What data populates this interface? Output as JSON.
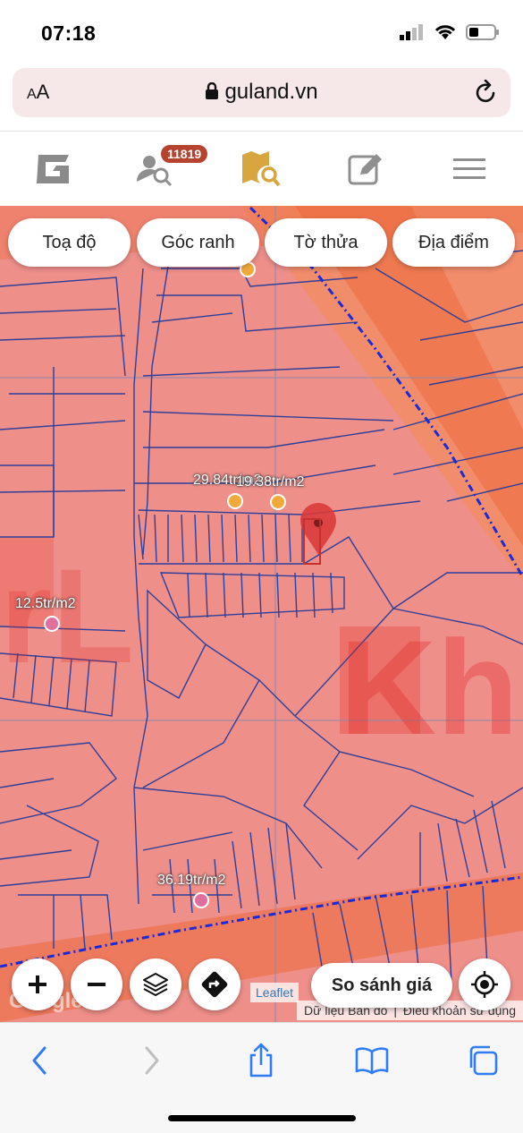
{
  "status_bar": {
    "time": "07:18"
  },
  "url_bar": {
    "text_size_label": "AA",
    "domain": "guland.vn",
    "lock_icon": "lock-icon",
    "reload_icon": "reload-icon"
  },
  "app_nav": {
    "items": [
      {
        "name": "logo",
        "icon": "guland-logo"
      },
      {
        "name": "search-people",
        "icon": "user-search-icon",
        "badge": "11819"
      },
      {
        "name": "map-search",
        "icon": "map-search-icon"
      },
      {
        "name": "post",
        "icon": "edit-icon"
      },
      {
        "name": "menu",
        "icon": "hamburger-icon"
      }
    ]
  },
  "map": {
    "filters": [
      "Toạ độ",
      "Góc ranh",
      "Tờ thửa",
      "Địa điểm"
    ],
    "price_labels": [
      "29.84tr/m2",
      "19.38tr/m2",
      "12.5tr/m2",
      "36.19tr/m2"
    ],
    "controls": {
      "compare_label": "So sánh giá"
    },
    "attribution": {
      "leaflet": "Leaflet",
      "map_data": "Dữ liệu Bản đồ",
      "terms": "Điều khoản sử dụng",
      "google": "Google"
    },
    "colors": {
      "overlay": "#ef8f8a",
      "parcel_line": "#2d3f9a",
      "boundary": "#1a2ad8",
      "road": "#e8541f",
      "dot_orange": "#f2a93b",
      "dot_pink": "#e06fa0"
    }
  },
  "browser_toolbar": [
    "back-icon",
    "forward-icon",
    "share-icon",
    "bookmarks-icon",
    "tabs-icon"
  ]
}
